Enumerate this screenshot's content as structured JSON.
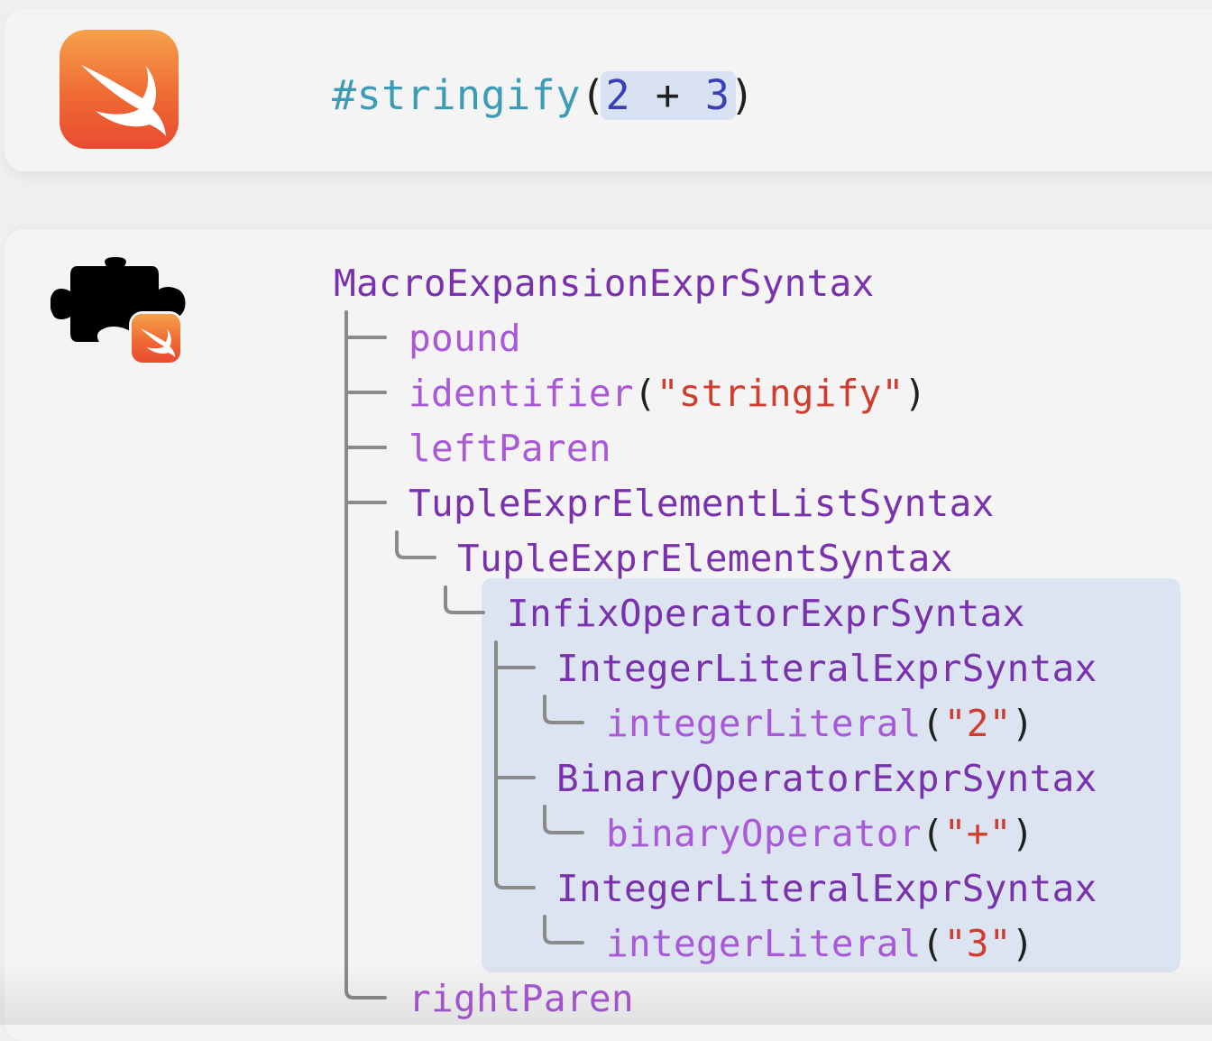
{
  "code": {
    "macro": "#stringify",
    "open_paren": "(",
    "lhs": "2",
    "operator": "+",
    "rhs": "3",
    "close_paren": ")"
  },
  "tree": {
    "root": "MacroExpansionExprSyntax",
    "pound": "pound",
    "identifier": "identifier",
    "identifier_value": "\"stringify\"",
    "left_paren": "leftParen",
    "tuple_list": "TupleExprElementListSyntax",
    "tuple_element": "TupleExprElementSyntax",
    "infix": "InfixOperatorExprSyntax",
    "lhs_node": "IntegerLiteralExprSyntax",
    "lhs_token": "integerLiteral",
    "lhs_value": "\"2\"",
    "op_node": "BinaryOperatorExprSyntax",
    "op_token": "binaryOperator",
    "op_value": "\"+\"",
    "rhs_node": "IntegerLiteralExprSyntax",
    "rhs_token": "integerLiteral",
    "rhs_value": "\"3\"",
    "right_paren": "rightParen",
    "open_paren": "(",
    "close_paren": ")"
  },
  "icons": {
    "app": "swift-app-icon",
    "macro": "macro-puzzle-icon"
  },
  "colors": {
    "type_name": "#7a31ad",
    "token_name": "#a958d8",
    "string_literal": "#cf3d2f",
    "macro_name": "#3c9bb6",
    "number": "#3a3fb5",
    "highlight": "#dce3f1"
  }
}
